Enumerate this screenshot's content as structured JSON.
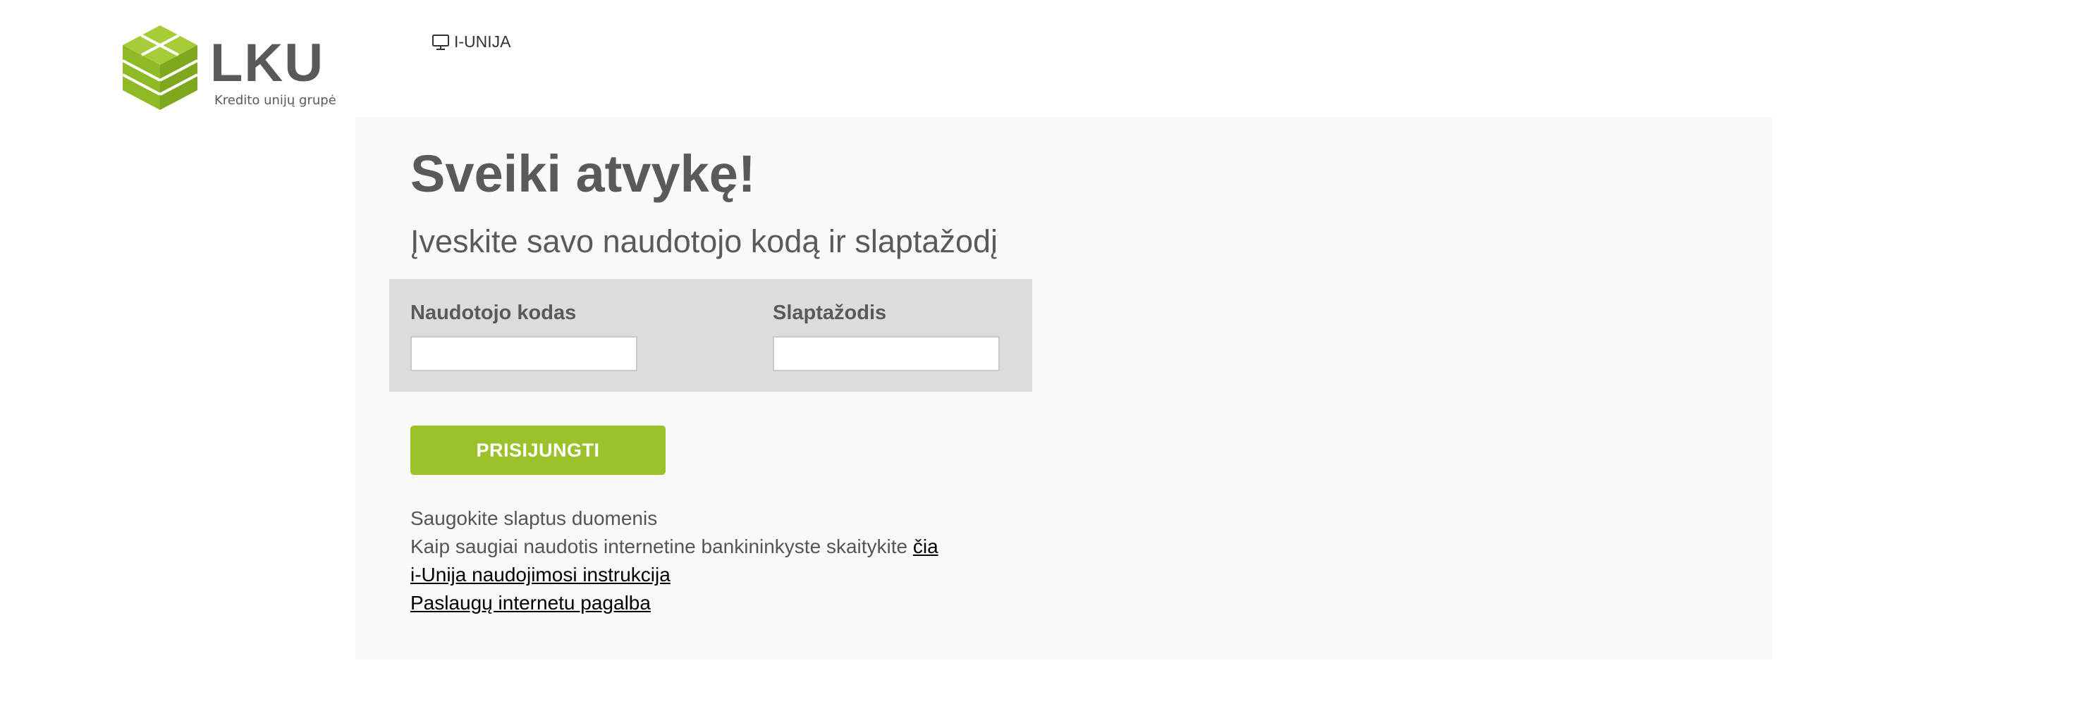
{
  "logo": {
    "name": "LKU",
    "tagline": "Kredito unijų grupė",
    "brand_color": "#9bc22b",
    "icon": "lku-cube-logo"
  },
  "top_nav": {
    "link_label": "I-UNIJA",
    "link_icon": "monitor-icon"
  },
  "main": {
    "title": "Sveiki atvykę!",
    "subtitle": "Įveskite savo naudotojo kodą ir slaptažodį"
  },
  "form": {
    "username_label": "Naudotojo kodas",
    "username_value": "",
    "password_label": "Slaptažodis",
    "password_value": "",
    "submit_label": "PRISIJUNGTI"
  },
  "info": {
    "line1": "Saugokite slaptus duomenis",
    "line2_text": "Kaip saugiai naudotis internetine bankininkyste skaitykite ",
    "line2_link": "čia",
    "link_instructions": "i-Unija naudojimosi instrukcija",
    "link_help": "Paslaugų internetu pagalba"
  },
  "colors": {
    "accent": "#9bc22b",
    "panel_bg": "#f9f9f9",
    "form_bg": "#dcdcdc",
    "text": "#5a5a5a"
  }
}
